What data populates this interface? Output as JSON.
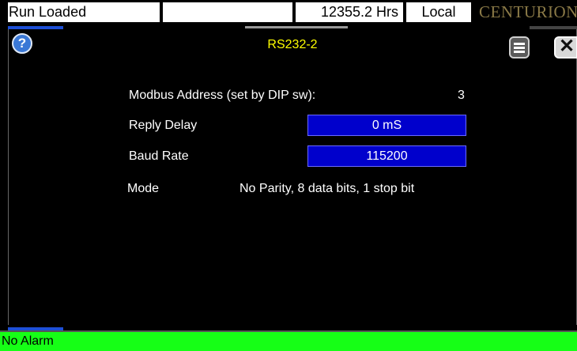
{
  "status_bar": {
    "run_status": "Run Loaded",
    "blank": "",
    "hours": "12355.2 Hrs",
    "mode": "Local",
    "brand": "CENTURION"
  },
  "dialog": {
    "title": "RS232-2",
    "help_glyph": "?",
    "close_glyph": "✕",
    "rows": {
      "modbus_address": {
        "label": "Modbus Address (set by DIP sw):",
        "value": "3"
      },
      "reply_delay": {
        "label": "Reply Delay",
        "value": "0 mS"
      },
      "baud_rate": {
        "label": "Baud Rate",
        "value": "115200"
      },
      "mode": {
        "label": "Mode",
        "value": "No Parity, 8 data bits, 1 stop bit"
      }
    }
  },
  "alarm_bar": {
    "text": "No Alarm"
  },
  "icons": {
    "help": "help-icon",
    "menu": "menu-icon",
    "close": "close-icon"
  },
  "colors": {
    "title": "#ffff00",
    "field_bg": "#0000cc",
    "alarm_bg": "#16ff16",
    "brand": "#8b7a47",
    "accent": "#1e4fd6"
  }
}
